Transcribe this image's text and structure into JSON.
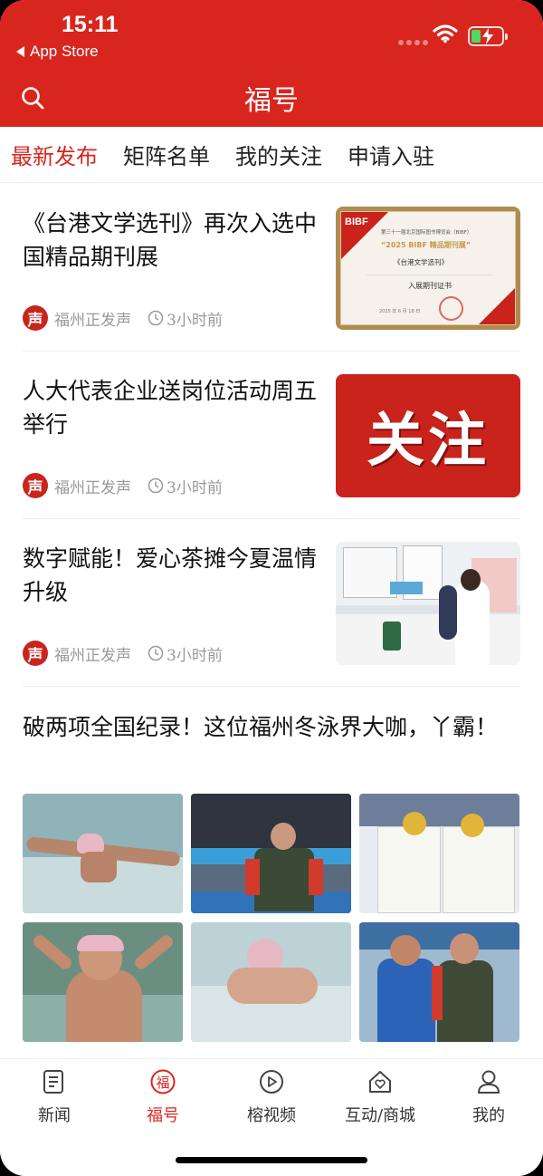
{
  "status_bar": {
    "time": "15:11",
    "back_label": "App Store"
  },
  "header": {
    "title": "福号",
    "search_icon": "search-icon"
  },
  "tabs": [
    {
      "label": "最新发布",
      "active": true
    },
    {
      "label": "矩阵名单",
      "active": false
    },
    {
      "label": "我的关注",
      "active": false
    },
    {
      "label": "申请入驻",
      "active": false
    }
  ],
  "articles": [
    {
      "title": "《台港文学选刊》再次入选中国精品期刊展",
      "source": "福州正发声",
      "time": "3小时前",
      "thumb": {
        "logo": "BIBF",
        "line1": "第三十一届北京国际图书博览会（BIBF）",
        "line2": "“2025 BIBF 精品期刊展”",
        "line3": "《台港文学选刊》",
        "line4": "入展期刊证书",
        "line5": "2025 年 6 月 18 日"
      }
    },
    {
      "title": "人大代表企业送岗位活动周五举行",
      "source": "福州正发声",
      "time": "3小时前",
      "thumb": {
        "text": "关注"
      }
    },
    {
      "title": "数字赋能！爱心茶摊今夏温情升级",
      "source": "福州正发声",
      "time": "3小时前"
    }
  ],
  "photo_article": {
    "title": "破两项全国纪录！这位福州冬泳界大咖，丫霸！"
  },
  "tabbar": [
    {
      "label": "新闻",
      "icon": "news-icon",
      "active": false
    },
    {
      "label": "福号",
      "icon": "fuhao-icon",
      "active": true
    },
    {
      "label": "榕视频",
      "icon": "video-icon",
      "active": false
    },
    {
      "label": "互动/商城",
      "icon": "home-heart-icon",
      "active": false
    },
    {
      "label": "我的",
      "icon": "user-icon",
      "active": false
    }
  ],
  "colors": {
    "brand_red": "#d8261f",
    "status_green": "#4cd964"
  }
}
